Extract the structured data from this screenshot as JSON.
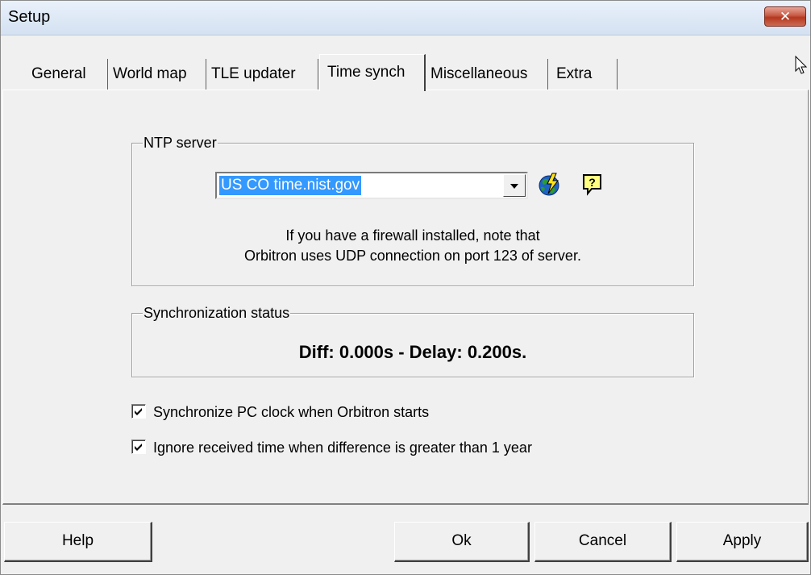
{
  "window": {
    "title": "Setup",
    "close_glyph": "✕"
  },
  "tabs": [
    {
      "label": "General",
      "active": false
    },
    {
      "label": "World map",
      "active": false
    },
    {
      "label": "TLE updater",
      "active": false
    },
    {
      "label": "Time synch",
      "active": true
    },
    {
      "label": "Miscellaneous",
      "active": false
    },
    {
      "label": "Extra",
      "active": false
    }
  ],
  "ntp": {
    "legend": "NTP server",
    "server_value": "US CO time.nist.gov",
    "note_line1": "If you have a firewall installed, note that",
    "note_line2": "Orbitron uses UDP connection on port 123 of server.",
    "icons": [
      "globe-lightning-icon",
      "help-icon"
    ]
  },
  "sync": {
    "legend": "Synchronization status",
    "status": "Diff: 0.000s - Delay: 0.200s."
  },
  "options": [
    {
      "label": "Synchronize PC clock when Orbitron starts",
      "checked": true
    },
    {
      "label": "Ignore received time when difference is greater than 1 year",
      "checked": true
    }
  ],
  "buttons": {
    "help": "Help",
    "ok": "Ok",
    "cancel": "Cancel",
    "apply": "Apply"
  },
  "colors": {
    "selection": "#3399ff",
    "close_button": "#c75944",
    "window_bg": "#f0f0f0"
  }
}
